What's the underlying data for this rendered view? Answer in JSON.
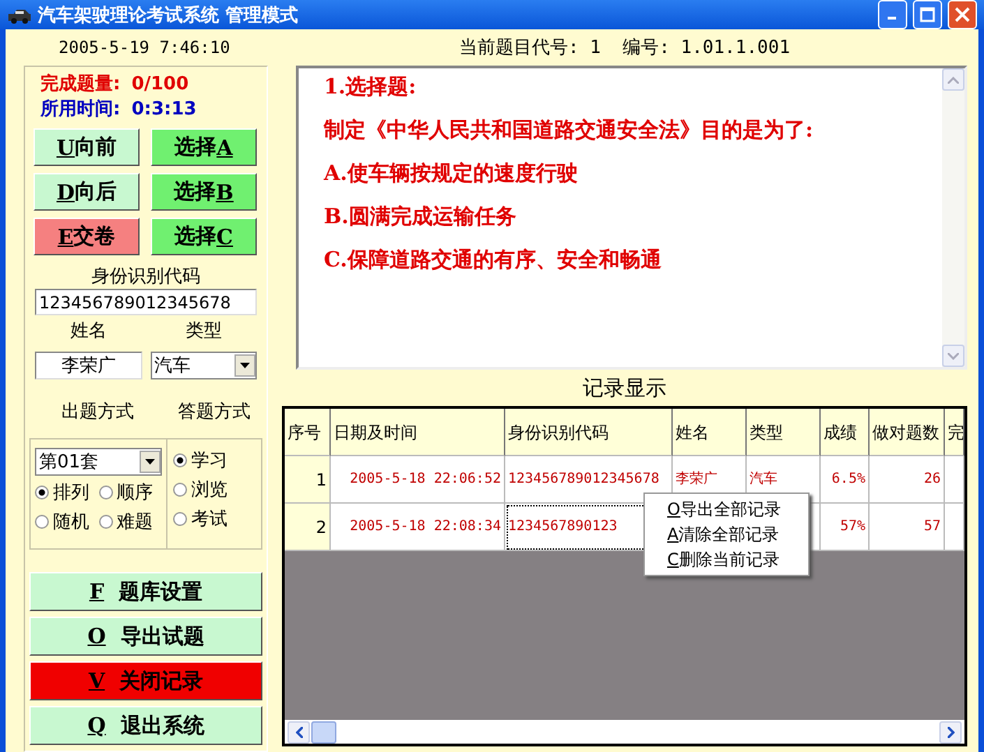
{
  "window": {
    "title": "汽车架驶理论考试系统 管理模式"
  },
  "datetime": "2005-5-19 7:46:10",
  "progress": {
    "label": "完成题量:",
    "value": "0/100"
  },
  "elapsed": {
    "label": "所用时间:",
    "value": "0:3:13"
  },
  "nav_buttons": [
    {
      "key": "U",
      "label": "向前",
      "kind": "nav"
    },
    {
      "key": "A",
      "label": "选择 ",
      "kind": "choice"
    },
    {
      "key": "D",
      "label": "向后",
      "kind": "nav"
    },
    {
      "key": "B",
      "label": "选择 ",
      "kind": "choice"
    },
    {
      "key": "E",
      "label": "交卷",
      "kind": "submit"
    },
    {
      "key": "C",
      "label": "选择 ",
      "kind": "choice"
    }
  ],
  "id_field": {
    "label": "身份识别代码",
    "value": "123456789012345678"
  },
  "name_field": {
    "label": "姓名",
    "value": "李荣广"
  },
  "type_field": {
    "label": "类型",
    "value": "汽车"
  },
  "mode_labels": [
    "出题方式",
    "答题方式"
  ],
  "set_select": {
    "value": "第01套"
  },
  "order_options": [
    {
      "label": "排列",
      "selected": true
    },
    {
      "label": "顺序",
      "selected": false
    },
    {
      "label": "随机",
      "selected": false
    },
    {
      "label": "难题",
      "selected": false
    }
  ],
  "answer_options": [
    {
      "label": "学习",
      "selected": true
    },
    {
      "label": "浏览",
      "selected": false
    },
    {
      "label": "考试",
      "selected": false
    }
  ],
  "action_buttons": [
    {
      "key": "F",
      "label": "题库设置",
      "kind": "normal"
    },
    {
      "key": "O",
      "label": "导出试题",
      "kind": "normal"
    },
    {
      "key": "V",
      "label": "关闭记录",
      "kind": "danger"
    },
    {
      "key": "Q",
      "label": "退出系统",
      "kind": "normal"
    }
  ],
  "question_header": "当前题目代号: 1  编号: 1.01.1.001",
  "question_lines": [
    "1.选择题:",
    "制定《中华人民共和国道路交通安全法》目的是为了:",
    "A.使车辆按规定的速度行驶",
    "B.圆满完成运输任务",
    "C.保障道路交通的有序、安全和畅通"
  ],
  "records_title": "记录显示",
  "table": {
    "columns": [
      "序号",
      "日期及时间",
      "身份识别代码",
      "姓名",
      "类型",
      "成绩",
      "做对题数",
      "完"
    ],
    "rows": [
      {
        "cells": [
          "1",
          "2005-5-18 22:06:52",
          "123456789012345678",
          "李荣广",
          "汽车",
          "6.5%",
          "26",
          ""
        ],
        "selected": false
      },
      {
        "cells": [
          "2",
          "2005-5-18 22:08:34",
          "1234567890123",
          "",
          "",
          "57%",
          "57",
          ""
        ],
        "selected": true
      }
    ]
  },
  "context_menu": [
    {
      "key": "O",
      "label": "导出全部记录"
    },
    {
      "key": "A",
      "label": "清除全部记录"
    },
    {
      "key": "C",
      "label": "删除当前记录"
    }
  ]
}
